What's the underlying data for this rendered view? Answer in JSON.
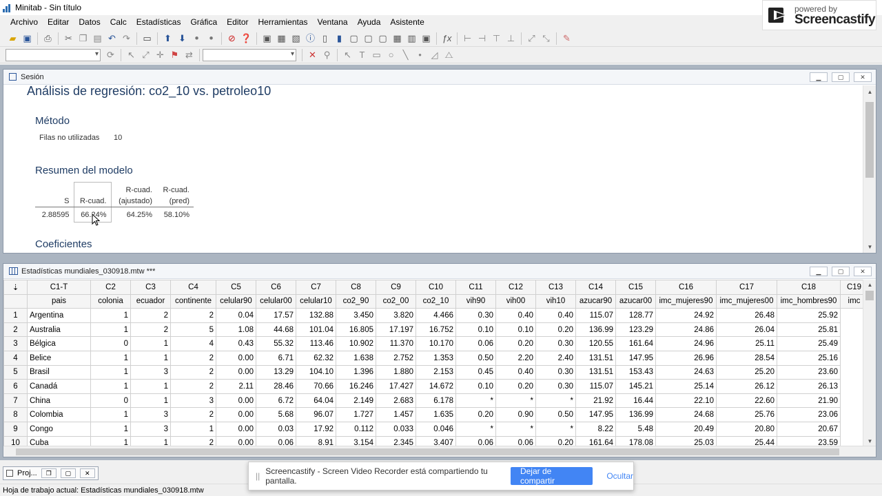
{
  "window": {
    "title": "Minitab - Sin título"
  },
  "watermark": {
    "line1": "powered by",
    "line2": "Screencastify"
  },
  "menu": [
    "Archivo",
    "Editar",
    "Datos",
    "Calc",
    "Estadísticas",
    "Gráfica",
    "Editor",
    "Herramientas",
    "Ventana",
    "Ayuda",
    "Asistente"
  ],
  "session": {
    "title": "Sesión",
    "heading": "Análisis de regresión: co2_10 vs. petroleo10",
    "metodo": "Método",
    "filas_label": "Filas no utilizadas",
    "filas_value": "10",
    "resumen": "Resumen del modelo",
    "summary_headers": {
      "s": "S",
      "rsq": "R-cuad.",
      "rsq_adj": "R-cuad.\n(ajustado)",
      "rsq_pred": "R-cuad.\n(pred)"
    },
    "summary_values": {
      "s": "2.88595",
      "rsq": "66.24%",
      "rsq_adj": "64.25%",
      "rsq_pred": "58.10%"
    },
    "coeficientes": "Coeficientes"
  },
  "worksheet": {
    "title": "Estadísticas mundiales_030918.mtw ***",
    "columns": [
      "C1-T",
      "C2",
      "C3",
      "C4",
      "C5",
      "C6",
      "C7",
      "C8",
      "C9",
      "C10",
      "C11",
      "C12",
      "C13",
      "C14",
      "C15",
      "C16",
      "C17",
      "C18",
      "C19"
    ],
    "names": [
      "pais",
      "colonia",
      "ecuador",
      "continente",
      "celular90",
      "celular00",
      "celular10",
      "co2_90",
      "co2_00",
      "co2_10",
      "vih90",
      "vih00",
      "vih10",
      "azucar90",
      "azucar00",
      "imc_mujeres90",
      "imc_mujeres00",
      "imc_hombres90",
      "imc"
    ],
    "rows": [
      [
        "1",
        "Argentina",
        "1",
        "2",
        "2",
        "0.04",
        "17.57",
        "132.88",
        "3.450",
        "3.820",
        "4.466",
        "0.30",
        "0.40",
        "0.40",
        "115.07",
        "128.77",
        "24.92",
        "26.48",
        "25.92"
      ],
      [
        "2",
        "Australia",
        "1",
        "2",
        "5",
        "1.08",
        "44.68",
        "101.04",
        "16.805",
        "17.197",
        "16.752",
        "0.10",
        "0.10",
        "0.20",
        "136.99",
        "123.29",
        "24.86",
        "26.04",
        "25.81"
      ],
      [
        "3",
        "Bélgica",
        "0",
        "1",
        "4",
        "0.43",
        "55.32",
        "113.46",
        "10.902",
        "11.370",
        "10.170",
        "0.06",
        "0.20",
        "0.30",
        "120.55",
        "161.64",
        "24.96",
        "25.11",
        "25.49"
      ],
      [
        "4",
        "Belice",
        "1",
        "1",
        "2",
        "0.00",
        "6.71",
        "62.32",
        "1.638",
        "2.752",
        "1.353",
        "0.50",
        "2.20",
        "2.40",
        "131.51",
        "147.95",
        "26.96",
        "28.54",
        "25.16"
      ],
      [
        "5",
        "Brasil",
        "1",
        "3",
        "2",
        "0.00",
        "13.29",
        "104.10",
        "1.396",
        "1.880",
        "2.153",
        "0.45",
        "0.40",
        "0.30",
        "131.51",
        "153.43",
        "24.63",
        "25.20",
        "23.60"
      ],
      [
        "6",
        "Canadá",
        "1",
        "1",
        "2",
        "2.11",
        "28.46",
        "70.66",
        "16.246",
        "17.427",
        "14.672",
        "0.10",
        "0.20",
        "0.30",
        "115.07",
        "145.21",
        "25.14",
        "26.12",
        "26.13"
      ],
      [
        "7",
        "China",
        "0",
        "1",
        "3",
        "0.00",
        "6.72",
        "64.04",
        "2.149",
        "2.683",
        "6.178",
        "*",
        "*",
        "*",
        "21.92",
        "16.44",
        "22.10",
        "22.60",
        "21.90"
      ],
      [
        "8",
        "Colombia",
        "1",
        "3",
        "2",
        "0.00",
        "5.68",
        "96.07",
        "1.727",
        "1.457",
        "1.635",
        "0.20",
        "0.90",
        "0.50",
        "147.95",
        "136.99",
        "24.68",
        "25.76",
        "23.06"
      ],
      [
        "9",
        "Congo",
        "1",
        "3",
        "1",
        "0.00",
        "0.03",
        "17.92",
        "0.112",
        "0.033",
        "0.046",
        "*",
        "*",
        "*",
        "8.22",
        "5.48",
        "20.49",
        "20.80",
        "20.67"
      ],
      [
        "10",
        "Cuba",
        "1",
        "1",
        "2",
        "0.00",
        "0.06",
        "8.91",
        "3.154",
        "2.345",
        "3.407",
        "0.06",
        "0.06",
        "0.20",
        "161.64",
        "178.08",
        "25.03",
        "25.44",
        "23.59"
      ]
    ]
  },
  "tray": {
    "project_label": "Proj..."
  },
  "share_bar": {
    "message": "Screencastify - Screen Video Recorder está compartiendo tu pantalla.",
    "stop_label": "Dejar de compartir",
    "hide_label": "Ocultar"
  },
  "status": {
    "text": "Hoja de trabajo actual: Estadísticas mundiales_030918.mtw"
  },
  "colors": {
    "heading": "#1f3c64",
    "mdi_bg": "#abb5c1",
    "share_button": "#4285f4"
  }
}
